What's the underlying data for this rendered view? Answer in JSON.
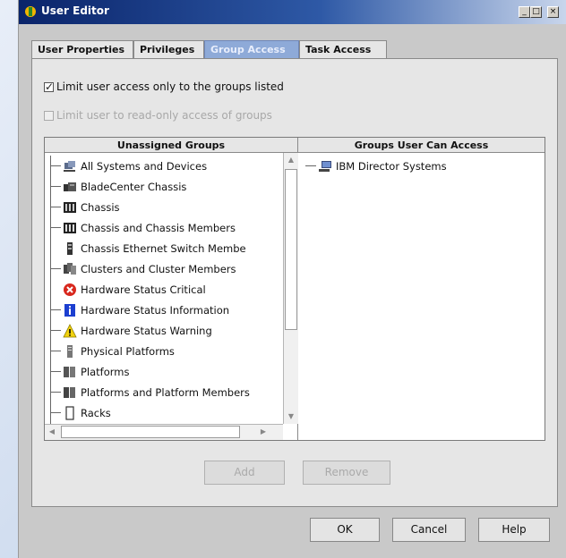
{
  "window": {
    "title": "User Editor",
    "controls": [
      "_",
      "□",
      "×"
    ]
  },
  "tabs": [
    {
      "label": "User Properties",
      "active": false
    },
    {
      "label": "Privileges",
      "active": false
    },
    {
      "label": "Group Access",
      "active": true
    },
    {
      "label": "Task Access",
      "active": false
    }
  ],
  "options": {
    "limit_groups_label": "Limit user access only to the groups listed",
    "limit_groups_checked": true,
    "readonly_label": "Limit user to read-only access of groups",
    "readonly_checked": false,
    "readonly_enabled": false
  },
  "unassigned": {
    "header": "Unassigned Groups",
    "items": [
      {
        "label": "All Systems and Devices",
        "icon": "all-systems-icon"
      },
      {
        "label": "BladeCenter Chassis",
        "icon": "bladecenter-icon"
      },
      {
        "label": "Chassis",
        "icon": "chassis-icon"
      },
      {
        "label": "Chassis and Chassis Members",
        "icon": "chassis-members-icon"
      },
      {
        "label": "Chassis Ethernet Switch Membe",
        "icon": "ethernet-switch-icon"
      },
      {
        "label": "Clusters and Cluster Members",
        "icon": "cluster-icon"
      },
      {
        "label": "Hardware Status Critical",
        "icon": "critical-icon"
      },
      {
        "label": "Hardware Status Information",
        "icon": "info-icon"
      },
      {
        "label": "Hardware Status Warning",
        "icon": "warning-icon"
      },
      {
        "label": "Physical Platforms",
        "icon": "physical-platform-icon"
      },
      {
        "label": "Platforms",
        "icon": "platforms-icon"
      },
      {
        "label": "Platforms and Platform Members",
        "icon": "platform-members-icon"
      },
      {
        "label": "Racks",
        "icon": "rack-icon"
      }
    ]
  },
  "accessible": {
    "header": "Groups User Can Access",
    "items": [
      {
        "label": "IBM Director Systems",
        "icon": "director-systems-icon"
      }
    ]
  },
  "actions": {
    "add": "Add",
    "remove": "Remove"
  },
  "footer": {
    "ok": "OK",
    "cancel": "Cancel",
    "help": "Help"
  }
}
